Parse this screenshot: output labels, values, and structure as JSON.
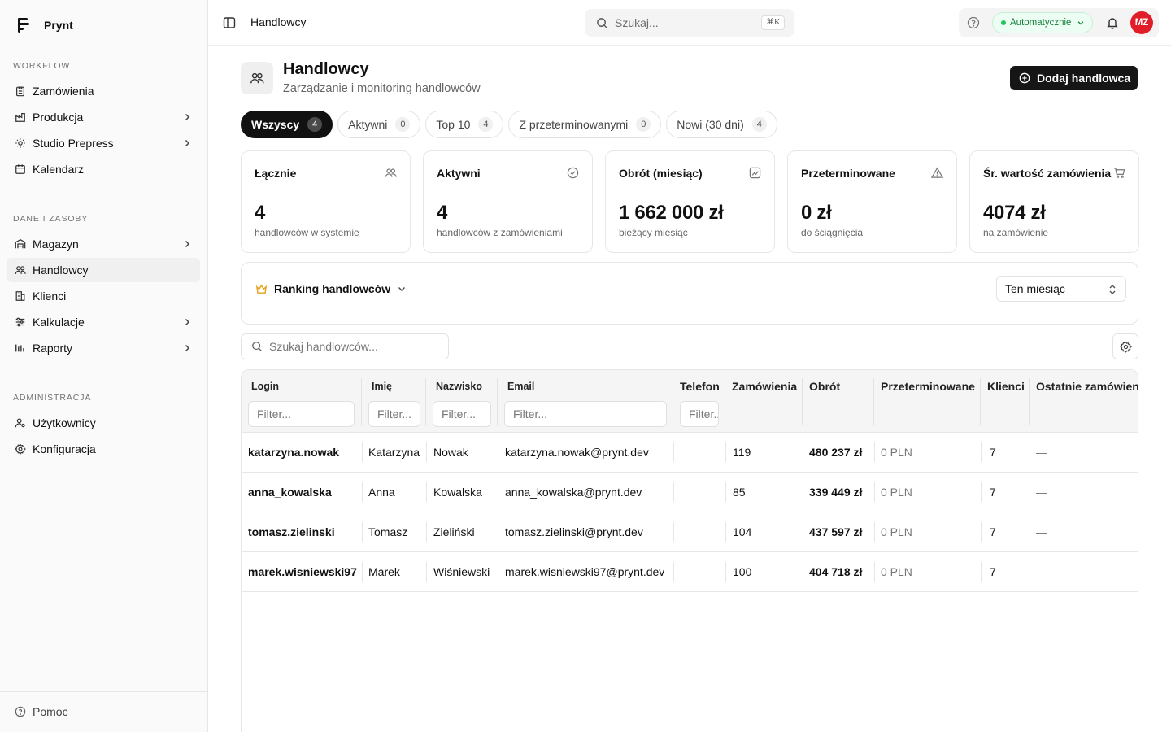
{
  "app": {
    "name": "Prynt"
  },
  "sidebar": {
    "sections": [
      {
        "title": "WORKFLOW",
        "items": [
          {
            "label": "Zamówienia",
            "icon": "clipboard-icon",
            "chevron": false
          },
          {
            "label": "Produkcja",
            "icon": "factory-icon",
            "chevron": true
          },
          {
            "label": "Studio Prepress",
            "icon": "sun-icon",
            "chevron": true
          },
          {
            "label": "Kalendarz",
            "icon": "calendar-icon",
            "chevron": false
          }
        ]
      },
      {
        "title": "DANE I ZASOBY",
        "items": [
          {
            "label": "Magazyn",
            "icon": "warehouse-icon",
            "chevron": true
          },
          {
            "label": "Handlowcy",
            "icon": "users-icon",
            "chevron": false,
            "active": true
          },
          {
            "label": "Klienci",
            "icon": "building-icon",
            "chevron": false
          },
          {
            "label": "Kalkulacje",
            "icon": "sliders-icon",
            "chevron": true
          },
          {
            "label": "Raporty",
            "icon": "chart-icon",
            "chevron": true
          }
        ]
      },
      {
        "title": "ADMINISTRACJA",
        "items": [
          {
            "label": "Użytkownicy",
            "icon": "user-cog-icon",
            "chevron": false
          },
          {
            "label": "Konfiguracja",
            "icon": "gear-icon",
            "chevron": false
          }
        ]
      }
    ],
    "footer": {
      "help_label": "Pomoc"
    }
  },
  "topbar": {
    "breadcrumb": "Handlowcy",
    "search_placeholder": "Szukaj...",
    "search_shortcut": "⌘K",
    "status_label": "Automatycznie",
    "avatar_initials": "MZ"
  },
  "page": {
    "title": "Handlowcy",
    "subtitle": "Zarządzanie i monitoring handlowców",
    "add_button": "Dodaj handlowca"
  },
  "tabs": [
    {
      "label": "Wszyscy",
      "count": "4",
      "active": true
    },
    {
      "label": "Aktywni",
      "count": "0"
    },
    {
      "label": "Top 10",
      "count": "4"
    },
    {
      "label": "Z przeterminowanymi",
      "count": "0"
    },
    {
      "label": "Nowi (30 dni)",
      "count": "4"
    }
  ],
  "stats": [
    {
      "title": "Łącznie",
      "value": "4",
      "desc": "handlowców w systemie",
      "icon": "users-icon"
    },
    {
      "title": "Aktywni",
      "value": "4",
      "desc": "handlowców z zamówieniami",
      "icon": "check-circle-icon"
    },
    {
      "title": "Obrót (miesiąc)",
      "value": "1 662 000 zł",
      "desc": "bieżący miesiąc",
      "icon": "trending-chart-icon"
    },
    {
      "title": "Przeterminowane",
      "value": "0 zł",
      "desc": "do ściągnięcia",
      "icon": "warning-icon"
    },
    {
      "title": "Śr. wartość zamówienia",
      "value": "4074 zł",
      "desc": "na zamówienie",
      "icon": "cart-icon"
    }
  ],
  "ranking": {
    "title": "Ranking handlowców",
    "period": "Ten miesiąc",
    "accent": "#e6a11a"
  },
  "table": {
    "search_placeholder": "Szukaj handlowców...",
    "filter_placeholder": "Filter...",
    "columns": [
      "Login",
      "Imię",
      "Nazwisko",
      "Email",
      "Telefon",
      "Zamówienia",
      "Obrót",
      "Przeterminowane",
      "Klienci",
      "Ostatnie zamówienie"
    ],
    "rows": [
      {
        "login": "katarzyna.nowak",
        "first": "Katarzyna",
        "last": "Nowak",
        "email": "katarzyna.nowak@prynt.dev",
        "phone": "",
        "orders": "119",
        "revenue": "480 237 zł",
        "overdue": "0 PLN",
        "clients": "7",
        "last_order": "—"
      },
      {
        "login": "anna_kowalska",
        "first": "Anna",
        "last": "Kowalska",
        "email": "anna_kowalska@prynt.dev",
        "phone": "",
        "orders": "85",
        "revenue": "339 449 zł",
        "overdue": "0 PLN",
        "clients": "7",
        "last_order": "—"
      },
      {
        "login": "tomasz.zielinski",
        "first": "Tomasz",
        "last": "Zieliński",
        "email": "tomasz.zielinski@prynt.dev",
        "phone": "",
        "orders": "104",
        "revenue": "437 597 zł",
        "overdue": "0 PLN",
        "clients": "7",
        "last_order": "—"
      },
      {
        "login": "marek.wisniewski97",
        "first": "Marek",
        "last": "Wiśniewski",
        "email": "marek.wisniewski97@prynt.dev",
        "phone": "",
        "orders": "100",
        "revenue": "404 718 zł",
        "overdue": "0 PLN",
        "clients": "7",
        "last_order": "—"
      }
    ]
  }
}
